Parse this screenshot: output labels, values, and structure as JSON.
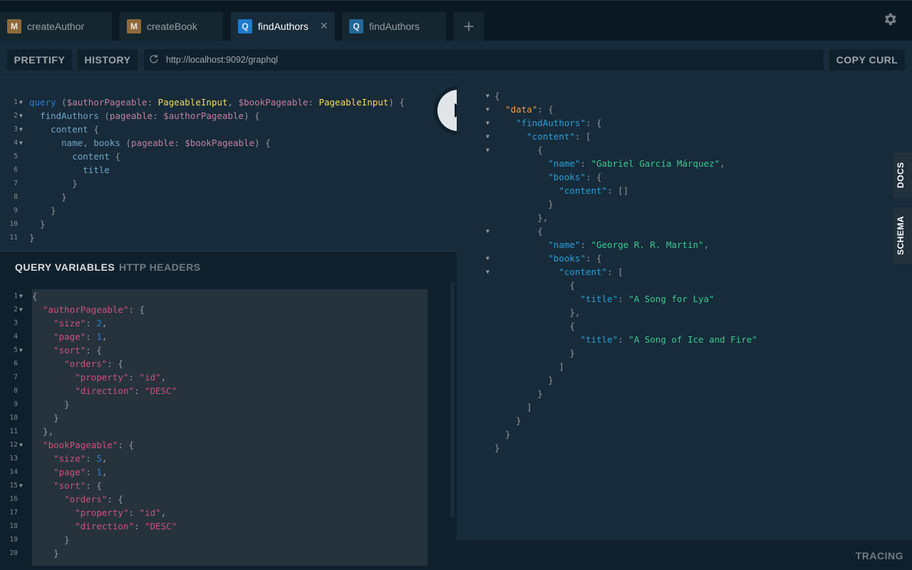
{
  "tabs": [
    {
      "badge": "M",
      "title": "createAuthor",
      "active": false
    },
    {
      "badge": "M",
      "title": "createBook",
      "active": false
    },
    {
      "badge": "Q",
      "title": "findAuthors",
      "active": true,
      "close": "×"
    },
    {
      "badge": "Q",
      "title": "findAuthors",
      "active": false
    }
  ],
  "new_tab_label": "+",
  "toolbar": {
    "prettify": "PRETTIFY",
    "history": "HISTORY",
    "url": "http://localhost:9092/graphql",
    "copy_curl": "COPY CURL"
  },
  "query_lines": [
    {
      "n": "1",
      "fold": true
    },
    {
      "n": "2",
      "fold": true
    },
    {
      "n": "3",
      "fold": true
    },
    {
      "n": "4",
      "fold": true
    },
    {
      "n": "5",
      "fold": false
    },
    {
      "n": "6",
      "fold": false
    },
    {
      "n": "7",
      "fold": false
    },
    {
      "n": "8",
      "fold": false
    },
    {
      "n": "9",
      "fold": false
    },
    {
      "n": "10",
      "fold": false
    },
    {
      "n": "11",
      "fold": false
    }
  ],
  "query_tokens": {
    "query": "query",
    "author_var": "$authorPageable",
    "book_var": "$bookPageable",
    "pageable_input": "PageableInput",
    "find_authors": "findAuthors",
    "pageable": "pageable",
    "content": "content",
    "name": "name",
    "books": "books",
    "title": "title"
  },
  "vars_tabs": {
    "query_variables": "QUERY VARIABLES",
    "http_headers": "HTTP HEADERS"
  },
  "vars_tokens": {
    "authorPageable": "\"authorPageable\"",
    "bookPageable": "\"bookPageable\"",
    "size": "\"size\"",
    "page": "\"page\"",
    "sort": "\"sort\"",
    "orders": "\"orders\"",
    "property": "\"property\"",
    "direction": "\"direction\"",
    "id": "\"id\"",
    "desc": "\"DESC\"",
    "v2": "2",
    "v1": "1",
    "v5": "5"
  },
  "result_tokens": {
    "data": "\"data\"",
    "findAuthors": "\"findAuthors\"",
    "content": "\"content\"",
    "name": "\"name\"",
    "books": "\"books\"",
    "title": "\"title\"",
    "author1": "\"Gabriel García Márquez\"",
    "author2": "\"George R. R. Martin\"",
    "book1": "\"A Song for Lya\"",
    "book2": "\"A Song of Ice and Fire\""
  },
  "side_tabs": {
    "docs": "DOCS",
    "schema": "SCHEMA"
  },
  "tracing": "TRACING",
  "colors": {
    "background": "#0f202d",
    "panel": "#172b3a",
    "mutation_badge": "#8f6a38",
    "query_badge": "#1f7ace"
  }
}
